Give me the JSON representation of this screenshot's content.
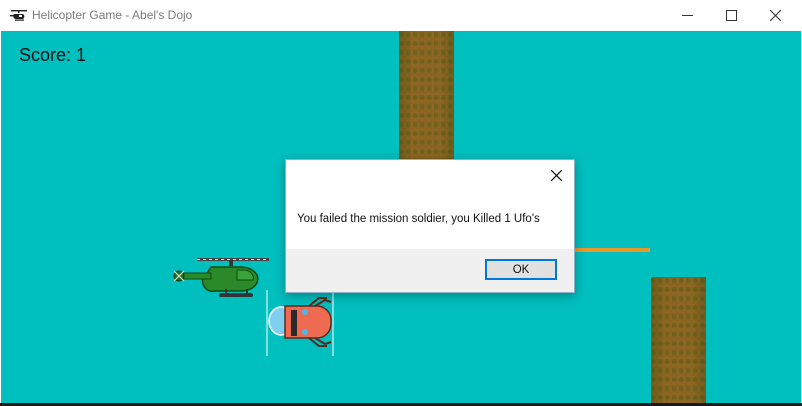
{
  "window": {
    "title": "Helicopter Game - Abel's Dojo",
    "icons": {
      "app": "helicopter-icon",
      "minimize": "minimize-icon",
      "maximize": "maximize-icon",
      "close": "close-icon"
    }
  },
  "game": {
    "score_text": "Score: 1",
    "background_color": "#00bfbf",
    "pillar_color": "#8a6420",
    "ledge_color": "#e89a2a"
  },
  "dialog": {
    "message": "You failed the mission soldier, you Killed 1 Ufo's",
    "ok_label": "OK",
    "close_icon": "close-icon"
  }
}
